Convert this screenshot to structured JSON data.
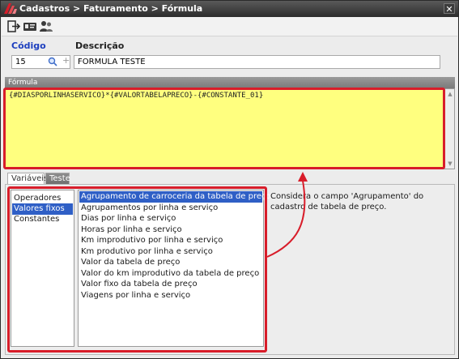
{
  "window": {
    "title": "Cadastros > Faturamento > Fórmula",
    "close_label": "✕"
  },
  "toolbar": {
    "buttons": [
      {
        "icon": "exit-icon"
      },
      {
        "icon": "id-card-icon"
      },
      {
        "icon": "users-icon"
      }
    ]
  },
  "form": {
    "code_label": "Código",
    "code_value": "15",
    "description_label": "Descrição",
    "description_value": "FORMULA TESTE"
  },
  "formula": {
    "section_title": "Fórmula",
    "text": "{#DIASPORLINHASERVICO}*{#VALORTABELAPRECO}-{#CONSTANTE_01}",
    "background_color": "#ffff7f"
  },
  "tabs": [
    {
      "label": "Variáveis"
    },
    {
      "label": "Teste"
    }
  ],
  "categories": {
    "items": [
      "Operadores",
      "Valores fixos",
      "Constantes"
    ],
    "selected_index": 1
  },
  "variables": {
    "items": [
      "Agrupamento de carroceria da tabela de preço",
      "Agrupamentos por linha e serviço",
      "Dias por linha e serviço",
      "Horas por linha e serviço",
      "Km improdutivo por linha e serviço",
      "Km produtivo por linha e serviço",
      "Valor da tabela de preço",
      "Valor do km improdutivo da tabela de preço",
      "Valor fixo da tabela de preço",
      "Viagens por linha e serviço"
    ],
    "selected_index": 0
  },
  "description": "Considera o campo 'Agrupamento' do cadastro de tabela de preço.",
  "colors": {
    "highlight": "#d81d2a",
    "selection": "#2f5fc6",
    "label_blue": "#1d3fbf"
  }
}
